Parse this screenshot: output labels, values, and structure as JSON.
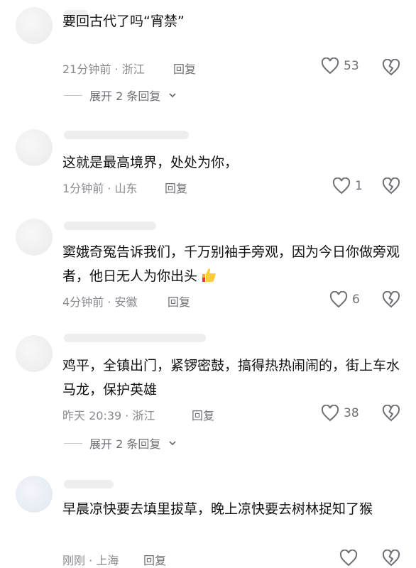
{
  "comments": [
    {
      "text": "要回古代了吗“宵禁”",
      "meta": "21分钟前 · 浙江",
      "reply_label": "回复",
      "likes": "53",
      "expand_label": "展开 2 条回复"
    },
    {
      "text": "这就是最高境界，处处为你，",
      "meta": "1分钟前 · 山东",
      "reply_label": "回复",
      "likes": "1"
    },
    {
      "text": "窦娥奇冤告诉我们，千万别袖手旁观，因为今日你做旁观者，他日无人为你出头",
      "meta": "4分钟前 · 安徽",
      "reply_label": "回复",
      "likes": "6",
      "emoji": "thumbs-up-emoji"
    },
    {
      "text": "鸡平，全镇出门，紧锣密鼓，搞得热热闹闹的，街上车水马龙，保护英雄",
      "meta": "昨天 20:39 · 浙江",
      "reply_label": "回复",
      "likes": "38",
      "expand_label": "展开 2 条回复"
    },
    {
      "text": "早晨凉快要去填里拔草，晚上凉快要去树林捉知了猴",
      "meta": "刚刚 · 上海",
      "reply_label": "回复",
      "likes": ""
    }
  ],
  "icons": {
    "like": "heart-outline-icon",
    "dislike": "broken-heart-icon",
    "expand": "chevron-down-icon"
  },
  "colors": {
    "text": "#111111",
    "meta": "#8a8b91",
    "icon": "#6f7076"
  }
}
